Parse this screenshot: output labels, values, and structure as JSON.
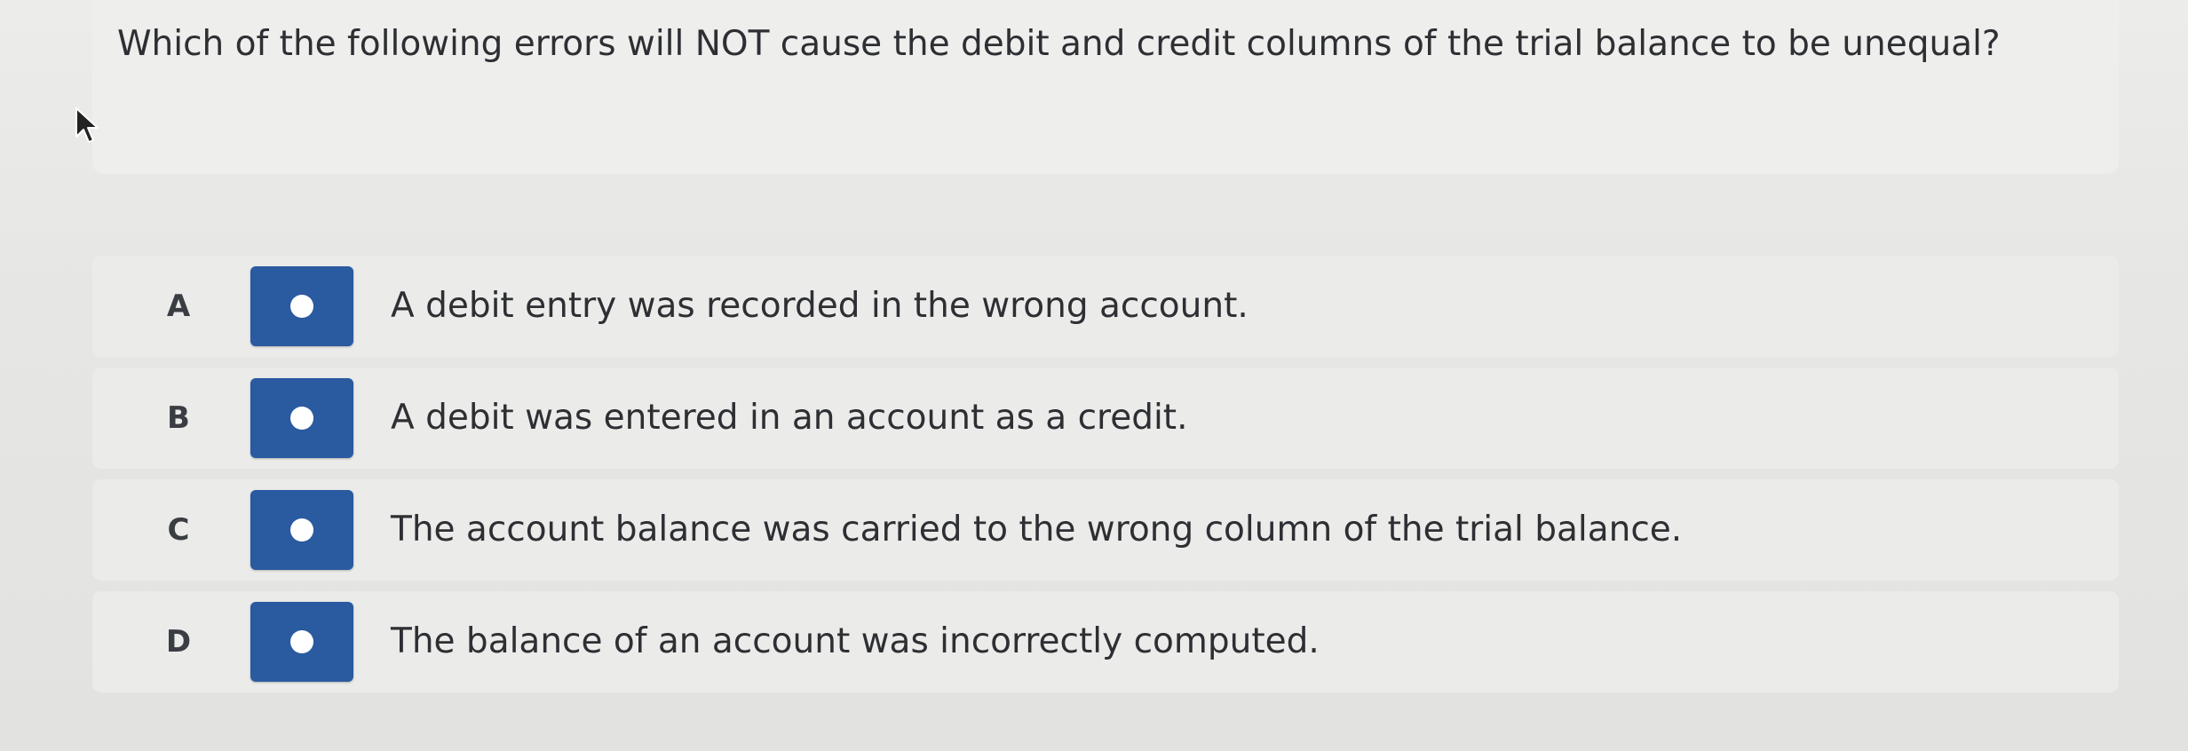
{
  "question": {
    "text": "Which of the following errors will NOT cause the debit and credit columns of the trial balance to be unequal?"
  },
  "options": [
    {
      "letter": "A",
      "text": "A debit entry was recorded in the wrong account."
    },
    {
      "letter": "B",
      "text": "A debit was entered in an account as a credit."
    },
    {
      "letter": "C",
      "text": "The account balance was carried to the wrong column of the trial balance."
    },
    {
      "letter": "D",
      "text": "The balance of an account was incorrectly computed."
    }
  ],
  "colors": {
    "radio_button": "#2a5aa0",
    "radio_dot": "#ffffff",
    "background": "#e6e6e4"
  },
  "icons": {
    "cursor": "mouse-pointer-icon",
    "radio_dot": "radio-dot-icon"
  }
}
